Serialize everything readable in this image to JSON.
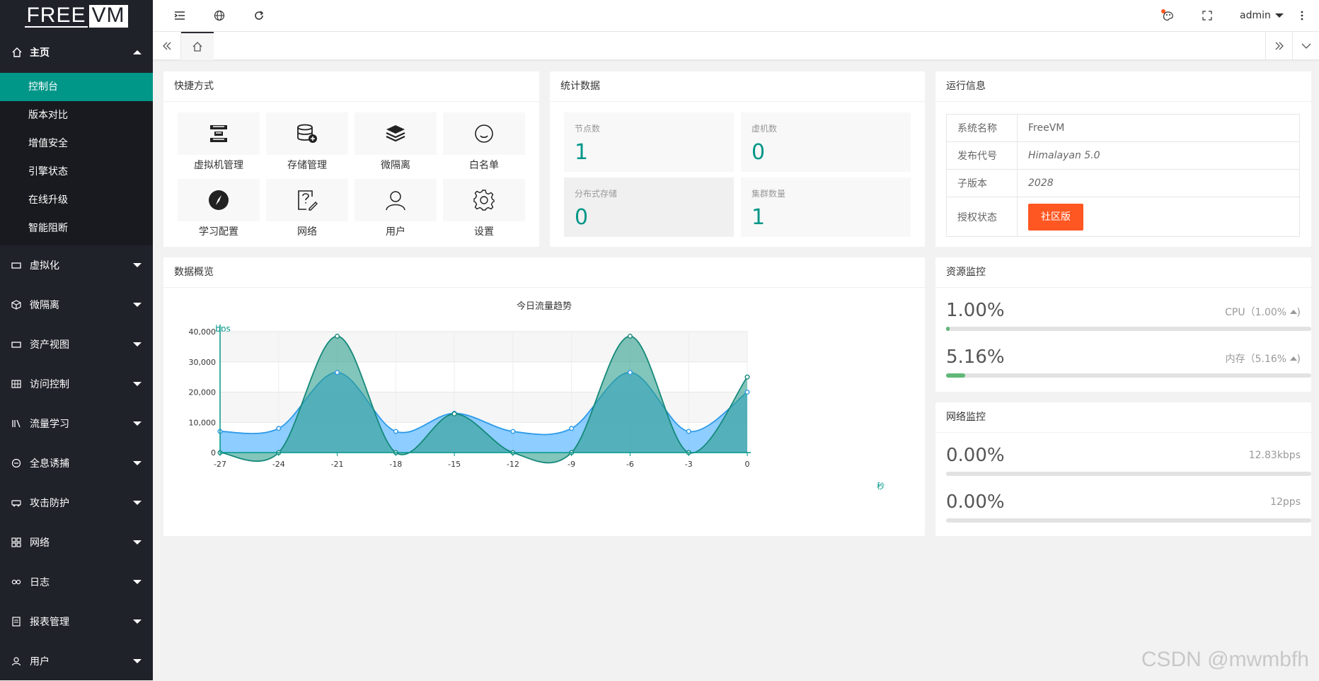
{
  "brand": {
    "left": "FREE",
    "right": "VM"
  },
  "nav": {
    "home": "主页",
    "sub_items": [
      "控制台",
      "版本对比",
      "增值安全",
      "引擎状态",
      "在线升级",
      "智能阻断"
    ],
    "groups": [
      "虚拟化",
      "微隔离",
      "资产视图",
      "访问控制",
      "流量学习",
      "全息诱捕",
      "攻击防护",
      "网络",
      "日志",
      "报表管理",
      "用户"
    ]
  },
  "topbar": {
    "user": "admin"
  },
  "shortcuts": {
    "title": "快捷方式",
    "items": [
      {
        "label": "虚拟机管理",
        "icon": "vm-manage-icon"
      },
      {
        "label": "存储管理",
        "icon": "storage-icon"
      },
      {
        "label": "微隔离",
        "icon": "layers-icon"
      },
      {
        "label": "白名单",
        "icon": "smile-icon"
      },
      {
        "label": "学习配置",
        "icon": "compass-icon"
      },
      {
        "label": "网络",
        "icon": "help-edit-icon"
      },
      {
        "label": "用户",
        "icon": "user-icon"
      },
      {
        "label": "设置",
        "icon": "gear-icon"
      }
    ]
  },
  "stats": {
    "title": "统计数据",
    "items": [
      {
        "label": "节点数",
        "value": "1"
      },
      {
        "label": "虚机数",
        "value": "0"
      },
      {
        "label": "分布式存储",
        "value": "0"
      },
      {
        "label": "集群数量",
        "value": "1"
      }
    ]
  },
  "run_info": {
    "title": "运行信息",
    "rows": [
      {
        "key": "系统名称",
        "value": "FreeVM"
      },
      {
        "key": "发布代号",
        "value": "Himalayan 5.0"
      },
      {
        "key": "子版本",
        "value": "2028"
      },
      {
        "key": "授权状态",
        "value": "社区版"
      }
    ]
  },
  "overview": {
    "title": "数据概览"
  },
  "chart_data": {
    "type": "area",
    "title": "今日流量趋势",
    "ylabel": "bps",
    "xlabel": "秒",
    "x": [
      "-27",
      "-24",
      "-21",
      "-18",
      "-15",
      "-12",
      "-9",
      "-6",
      "-3",
      "0"
    ],
    "yticks": [
      "0",
      "10,000",
      "20,000",
      "30,000",
      "40,000"
    ],
    "ylim": [
      0,
      40000
    ],
    "series": [
      {
        "values": [
          7000,
          8000,
          26500,
          7000,
          13000,
          7000,
          8000,
          26500,
          7000,
          20000
        ],
        "color": "#5db8ff"
      },
      {
        "values": [
          0,
          0,
          38500,
          0,
          12800,
          0,
          0,
          38500,
          0,
          25000
        ],
        "color": "#2e9e8e"
      }
    ]
  },
  "resource": {
    "title": "资源监控",
    "cpu": {
      "value": "1.00%",
      "label": "CPU（1.00%",
      "fraction": 0.01
    },
    "mem": {
      "value": "5.16%",
      "label": "内存（5.16%",
      "fraction": 0.0516
    }
  },
  "network": {
    "title": "网络监控",
    "a": {
      "value": "0.00%",
      "label": "12.83kbps"
    },
    "b": {
      "value": "0.00%",
      "label": "12pps"
    }
  },
  "watermark": "CSDN @mwmbfh"
}
